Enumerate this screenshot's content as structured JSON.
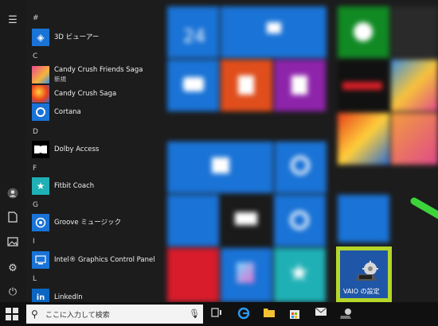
{
  "app_list": {
    "groups": [
      {
        "letter": "#",
        "apps": [
          {
            "name": "3D ビューアー",
            "sub": ""
          }
        ]
      },
      {
        "letter": "C",
        "apps": [
          {
            "name": "Candy Crush Friends Saga",
            "sub": "新規"
          },
          {
            "name": "Candy Crush Saga",
            "sub": ""
          },
          {
            "name": "Cortana",
            "sub": ""
          }
        ]
      },
      {
        "letter": "D",
        "apps": [
          {
            "name": "Dolby Access",
            "sub": ""
          }
        ]
      },
      {
        "letter": "F",
        "apps": [
          {
            "name": "Fitbit Coach",
            "sub": ""
          }
        ]
      },
      {
        "letter": "G",
        "apps": [
          {
            "name": "Groove ミュージック",
            "sub": ""
          }
        ]
      },
      {
        "letter": "I",
        "apps": [
          {
            "name": "Intel® Graphics Control Panel",
            "sub": ""
          }
        ]
      },
      {
        "letter": "L",
        "apps": [
          {
            "name": "LinkedIn",
            "sub": ""
          }
        ]
      }
    ]
  },
  "tiles": {
    "calendar_date": "24",
    "highlighted_tile_label": "VAIO の設定"
  },
  "taskbar": {
    "search_placeholder": "ここに入力して検索"
  },
  "colors": {
    "highlight_border": "#b5d62a",
    "arrow": "#3cd43a",
    "tile_blue": "#1a73d6"
  }
}
